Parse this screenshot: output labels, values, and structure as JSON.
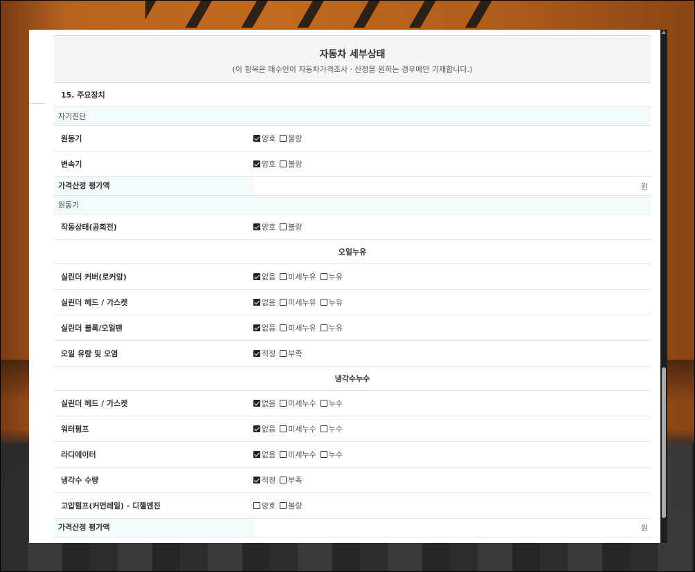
{
  "title": "자동차 세부상태",
  "subtitle": "(이 항목은 매수인이 자동차가격조사ㆍ산정을 원하는 경우에만 기재합니다.)",
  "section": "15. 주요장치",
  "subs": {
    "self_diag": "자기진단",
    "engine": "원동기"
  },
  "rows": {
    "engine": {
      "label": "원동기",
      "opts": [
        "양호",
        "불량"
      ],
      "checked": [
        true,
        false
      ]
    },
    "transmission": {
      "label": "변속기",
      "opts": [
        "양호",
        "불량"
      ],
      "checked": [
        true,
        false
      ]
    },
    "idle": {
      "label": "작동상태(공회전)",
      "opts": [
        "양호",
        "불량"
      ],
      "checked": [
        true,
        false
      ]
    },
    "cyl_cover": {
      "label": "실린더 커버(로커암)",
      "opts": [
        "없음",
        "미세누유",
        "누유"
      ],
      "checked": [
        true,
        false,
        false
      ]
    },
    "cyl_head_oil": {
      "label": "실린더 헤드 / 가스켓",
      "opts": [
        "없음",
        "미세누유",
        "누유"
      ],
      "checked": [
        true,
        false,
        false
      ]
    },
    "cyl_block": {
      "label": "실린더 블록/오일팬",
      "opts": [
        "없음",
        "미세누유",
        "누유"
      ],
      "checked": [
        true,
        false,
        false
      ]
    },
    "oil_level": {
      "label": "오일 유량 및 오염",
      "opts": [
        "적정",
        "부족"
      ],
      "checked": [
        true,
        false
      ]
    },
    "cyl_head_cool": {
      "label": "실린더 헤드 / 가스켓",
      "opts": [
        "없음",
        "미세누수",
        "누수"
      ],
      "checked": [
        true,
        false,
        false
      ]
    },
    "water_pump": {
      "label": "워터펌프",
      "opts": [
        "없음",
        "미세누수",
        "누수"
      ],
      "checked": [
        true,
        false,
        false
      ]
    },
    "radiator": {
      "label": "라디에이터",
      "opts": [
        "없음",
        "미세누수",
        "누수"
      ],
      "checked": [
        true,
        false,
        false
      ]
    },
    "coolant": {
      "label": "냉각수 수량",
      "opts": [
        "적정",
        "부족"
      ],
      "checked": [
        true,
        false
      ]
    },
    "hp_pump": {
      "label": "고압펌프(커먼레일) - 디젤엔진",
      "opts": [
        "양호",
        "불량"
      ],
      "checked": [
        false,
        false
      ]
    }
  },
  "groups": {
    "oil_leak": "오일누유",
    "coolant_leak": "냉각수누수"
  },
  "price": {
    "label": "가격산정 평가액",
    "unit": "원"
  }
}
